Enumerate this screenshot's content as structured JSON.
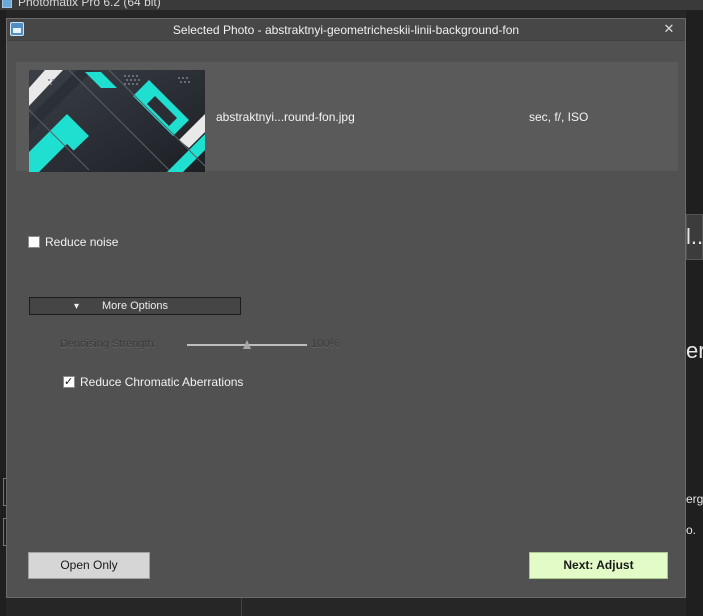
{
  "background_app": {
    "title": "Photomatix Pro 6.2 (64 bit)",
    "side_fragments": [
      "l...",
      "er",
      "erg",
      "o."
    ]
  },
  "dialog": {
    "title": "Selected Photo - abstraktnyi-geometricheskii-linii-background-fon",
    "photo": {
      "name": "abstraktnyi...round-fon.jpg",
      "exif": "sec, f/, ISO"
    },
    "reduce_noise": {
      "label": "Reduce noise",
      "checked": false
    },
    "more_options": {
      "label": "More Options"
    },
    "denoising": {
      "label": "Denoising Strength:",
      "value": "100%",
      "level_fraction": 0.5
    },
    "chromatic": {
      "label": "Reduce Chromatic Aberrations",
      "checked": true
    },
    "buttons": {
      "open_only": "Open Only",
      "next": "Next: Adjust"
    }
  },
  "colors": {
    "dialog_bg": "#515151",
    "next_button_bg": "#e3fbc7",
    "thumb_accent": "#1fe0d0"
  }
}
